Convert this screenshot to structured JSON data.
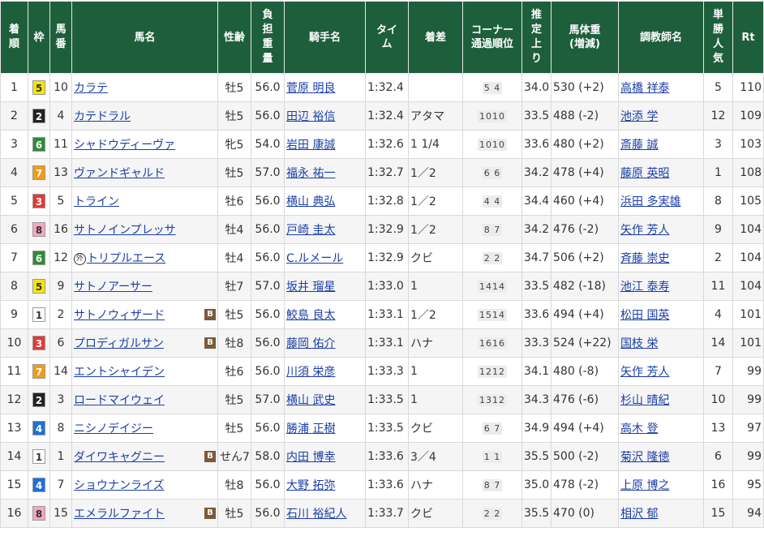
{
  "headers": [
    "着順",
    "枠",
    "馬番",
    "馬名",
    "性齢",
    "負担重量",
    "騎手名",
    "タイム",
    "着差",
    "コーナー通過順位",
    "推定上り",
    "馬体重(増減)",
    "調教師名",
    "単勝人気",
    "Rt"
  ],
  "header_display": {
    "rank": "着\n順",
    "frame": "枠",
    "num": "馬\n番",
    "horse": "馬名",
    "sexage": "性齢",
    "weight": "負\n担\n重\n量",
    "jockey": "騎手名",
    "time": "タイ\nム",
    "margin": "着差",
    "corner": "コーナー\n通過順位",
    "last3f": "推\n定\n上\nり",
    "bodyweight": "馬体重\n(増減)",
    "trainer": "調教師名",
    "pop": "単\n勝\n人\n気",
    "rt": "Rt"
  },
  "frame_colors": {
    "1": {
      "bg": "#ffffff",
      "fg": "#333333"
    },
    "2": {
      "bg": "#222222",
      "fg": "#ffffff"
    },
    "3": {
      "bg": "#e53935",
      "fg": "#ffffff"
    },
    "4": {
      "bg": "#1e6fd9",
      "fg": "#ffffff"
    },
    "5": {
      "bg": "#f5e600",
      "fg": "#333333"
    },
    "6": {
      "bg": "#2e8b3a",
      "fg": "#ffffff"
    },
    "7": {
      "bg": "#f39c12",
      "fg": "#ffffff"
    },
    "8": {
      "bg": "#f7a6c0",
      "fg": "#333333"
    }
  },
  "blinker_label": "B",
  "foreign_label": "外",
  "rows": [
    {
      "rank": "1",
      "frame": "5",
      "num": "10",
      "horse": "カラテ",
      "blinker": false,
      "foreign": false,
      "sexage": "牡5",
      "weight": "56.0",
      "jockey": "菅原 明良",
      "time": "1:32.4",
      "margin": "",
      "corner": "5 4",
      "last3f": "34.0",
      "bodyweight": "530 (+2)",
      "trainer": "高橋 祥泰",
      "pop": "5",
      "rt": "110"
    },
    {
      "rank": "2",
      "frame": "2",
      "num": "4",
      "horse": "カテドラル",
      "blinker": false,
      "foreign": false,
      "sexage": "牡5",
      "weight": "56.0",
      "jockey": "田辺 裕信",
      "time": "1:32.4",
      "margin": "アタマ",
      "corner": "1010",
      "last3f": "33.5",
      "bodyweight": "488 (-2)",
      "trainer": "池添 学",
      "pop": "12",
      "rt": "109"
    },
    {
      "rank": "3",
      "frame": "6",
      "num": "11",
      "horse": "シャドウディーヴァ",
      "blinker": false,
      "foreign": false,
      "sexage": "牝5",
      "weight": "54.0",
      "jockey": "岩田 康誠",
      "time": "1:32.6",
      "margin": "1 1/4",
      "corner": "1010",
      "last3f": "33.6",
      "bodyweight": "480 (+2)",
      "trainer": "斎藤 誠",
      "pop": "3",
      "rt": "103"
    },
    {
      "rank": "4",
      "frame": "7",
      "num": "13",
      "horse": "ヴァンドギャルド",
      "blinker": false,
      "foreign": false,
      "sexage": "牡5",
      "weight": "57.0",
      "jockey": "福永 祐一",
      "time": "1:32.7",
      "margin": "1／2",
      "corner": "6 6",
      "last3f": "34.2",
      "bodyweight": "478 (+4)",
      "trainer": "藤原 英昭",
      "pop": "1",
      "rt": "108"
    },
    {
      "rank": "5",
      "frame": "3",
      "num": "5",
      "horse": "トライン",
      "blinker": false,
      "foreign": false,
      "sexage": "牡6",
      "weight": "56.0",
      "jockey": "横山 典弘",
      "time": "1:32.8",
      "margin": "1／2",
      "corner": "4 4",
      "last3f": "34.4",
      "bodyweight": "460 (+4)",
      "trainer": "浜田 多実雄",
      "pop": "8",
      "rt": "105"
    },
    {
      "rank": "6",
      "frame": "8",
      "num": "16",
      "horse": "サトノインプレッサ",
      "blinker": false,
      "foreign": false,
      "sexage": "牡4",
      "weight": "56.0",
      "jockey": "戸崎 圭太",
      "time": "1:32.9",
      "margin": "1／2",
      "corner": "8 7",
      "last3f": "34.2",
      "bodyweight": "476 (-2)",
      "trainer": "矢作 芳人",
      "pop": "9",
      "rt": "104"
    },
    {
      "rank": "7",
      "frame": "6",
      "num": "12",
      "horse": "トリプルエース",
      "blinker": false,
      "foreign": true,
      "sexage": "牡4",
      "weight": "56.0",
      "jockey": "C.ルメール",
      "time": "1:32.9",
      "margin": "クビ",
      "corner": "2 2",
      "last3f": "34.7",
      "bodyweight": "506 (+2)",
      "trainer": "斉藤 崇史",
      "pop": "2",
      "rt": "104"
    },
    {
      "rank": "8",
      "frame": "5",
      "num": "9",
      "horse": "サトノアーサー",
      "blinker": false,
      "foreign": false,
      "sexage": "牡7",
      "weight": "57.0",
      "jockey": "坂井 瑠星",
      "time": "1:33.0",
      "margin": "1",
      "corner": "1414",
      "last3f": "33.5",
      "bodyweight": "482 (-18)",
      "trainer": "池江 泰寿",
      "pop": "11",
      "rt": "104"
    },
    {
      "rank": "9",
      "frame": "1",
      "num": "2",
      "horse": "サトノウィザード",
      "blinker": true,
      "foreign": false,
      "sexage": "牡5",
      "weight": "56.0",
      "jockey": "鮫島 良太",
      "time": "1:33.1",
      "margin": "1／2",
      "corner": "1514",
      "last3f": "33.6",
      "bodyweight": "494 (+4)",
      "trainer": "松田 国英",
      "pop": "4",
      "rt": "101"
    },
    {
      "rank": "10",
      "frame": "3",
      "num": "6",
      "horse": "プロディガルサン",
      "blinker": true,
      "foreign": false,
      "sexage": "牡8",
      "weight": "56.0",
      "jockey": "藤岡 佑介",
      "time": "1:33.1",
      "margin": "ハナ",
      "corner": "1616",
      "last3f": "33.3",
      "bodyweight": "524 (+22)",
      "trainer": "国枝 栄",
      "pop": "14",
      "rt": "101"
    },
    {
      "rank": "11",
      "frame": "7",
      "num": "14",
      "horse": "エントシャイデン",
      "blinker": false,
      "foreign": false,
      "sexage": "牡6",
      "weight": "56.0",
      "jockey": "川須 栄彦",
      "time": "1:33.3",
      "margin": "1",
      "corner": "1212",
      "last3f": "34.1",
      "bodyweight": "480 (-8)",
      "trainer": "矢作 芳人",
      "pop": "7",
      "rt": "99"
    },
    {
      "rank": "12",
      "frame": "2",
      "num": "3",
      "horse": "ロードマイウェイ",
      "blinker": false,
      "foreign": false,
      "sexage": "牡5",
      "weight": "57.0",
      "jockey": "横山 武史",
      "time": "1:33.5",
      "margin": "1",
      "corner": "1312",
      "last3f": "34.3",
      "bodyweight": "476 (-6)",
      "trainer": "杉山 晴紀",
      "pop": "10",
      "rt": "99"
    },
    {
      "rank": "13",
      "frame": "4",
      "num": "8",
      "horse": "ニシノデイジー",
      "blinker": false,
      "foreign": false,
      "sexage": "牡5",
      "weight": "56.0",
      "jockey": "勝浦 正樹",
      "time": "1:33.5",
      "margin": "クビ",
      "corner": "6 7",
      "last3f": "34.9",
      "bodyweight": "494 (+4)",
      "trainer": "高木 登",
      "pop": "13",
      "rt": "97"
    },
    {
      "rank": "14",
      "frame": "1",
      "num": "1",
      "horse": "ダイワキャグニー",
      "blinker": true,
      "foreign": false,
      "sexage": "せん7",
      "weight": "58.0",
      "jockey": "内田 博幸",
      "time": "1:33.6",
      "margin": "3／4",
      "corner": "1 1",
      "last3f": "35.5",
      "bodyweight": "500 (-2)",
      "trainer": "菊沢 隆徳",
      "pop": "6",
      "rt": "99"
    },
    {
      "rank": "15",
      "frame": "4",
      "num": "7",
      "horse": "ショウナンライズ",
      "blinker": false,
      "foreign": false,
      "sexage": "牡8",
      "weight": "56.0",
      "jockey": "大野 拓弥",
      "time": "1:33.6",
      "margin": "ハナ",
      "corner": "8 7",
      "last3f": "35.0",
      "bodyweight": "478 (-2)",
      "trainer": "上原 博之",
      "pop": "16",
      "rt": "95"
    },
    {
      "rank": "16",
      "frame": "8",
      "num": "15",
      "horse": "エメラルファイト",
      "blinker": true,
      "foreign": false,
      "sexage": "牡5",
      "weight": "56.0",
      "jockey": "石川 裕紀人",
      "time": "1:33.7",
      "margin": "クビ",
      "corner": "2 2",
      "last3f": "35.5",
      "bodyweight": "470 (0)",
      "trainer": "相沢 郁",
      "pop": "15",
      "rt": "94"
    }
  ]
}
